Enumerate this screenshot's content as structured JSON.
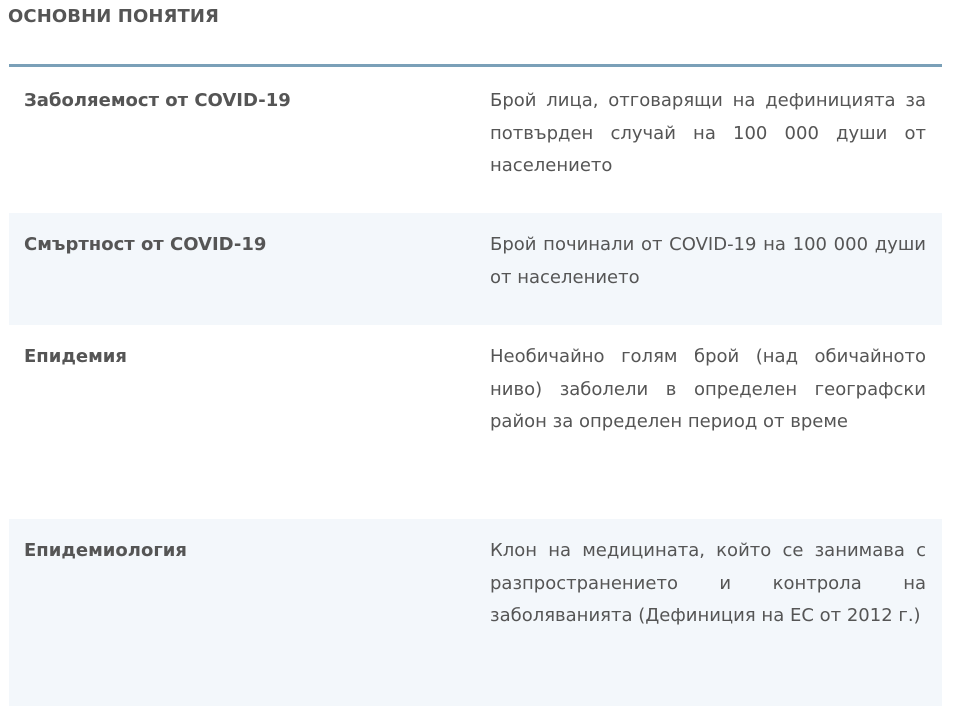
{
  "section": {
    "title": "ОСНОВНИ ПОНЯТИЯ"
  },
  "rows": [
    {
      "term": "Заболяемост от COVID-19",
      "definition": "Брой лица, отговарящи на дефиницията за потвърден случай на 100 000 души от населението"
    },
    {
      "term": "Смъртност от COVID-19",
      "definition": "Брой починали  от COVID-19 на 100 000 души от населението"
    },
    {
      "term": "Епидемия",
      "definition": "Необичайно голям брой (над обичайното ниво) заболели в определен географски район за определен период от време"
    },
    {
      "term": "Епидемиология",
      "definition": "Клон на медицината, който се занимава с разпространението и контрола на заболяванията (Дефиниция на ЕС от 2012 г.)"
    }
  ]
}
